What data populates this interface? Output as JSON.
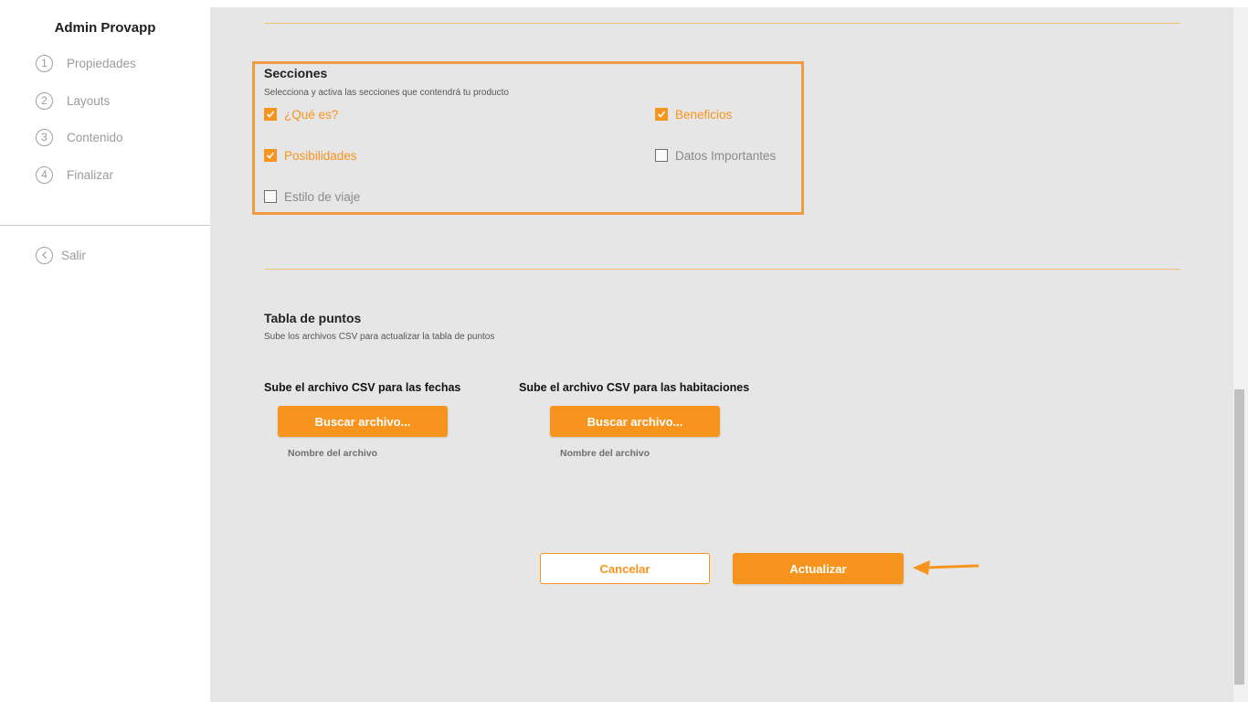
{
  "sidebar": {
    "brand": "Admin Provapp",
    "steps": [
      {
        "num": "1",
        "label": "Propiedades"
      },
      {
        "num": "2",
        "label": "Layouts"
      },
      {
        "num": "3",
        "label": "Contenido"
      },
      {
        "num": "4",
        "label": "Finalizar"
      }
    ],
    "exit_label": "Salir"
  },
  "sections": {
    "title": "Secciones",
    "subtitle": "Selecciona y activa las secciones que contendrá tu producto",
    "items": [
      {
        "label": "¿Qué es?",
        "checked": true
      },
      {
        "label": "Beneficios",
        "checked": true
      },
      {
        "label": "Posibilidades",
        "checked": true
      },
      {
        "label": "Datos Importantes",
        "checked": false
      },
      {
        "label": "Estilo de viaje",
        "checked": false
      }
    ]
  },
  "points_table": {
    "title": "Tabla de puntos",
    "subtitle": "Sube los archivos CSV para actualizar la tabla de puntos",
    "uploads": [
      {
        "label": "Sube el archivo CSV para las fechas",
        "button": "Buscar archivo...",
        "file_name": "Nombre del archivo"
      },
      {
        "label": "Sube el archivo CSV para las habitaciones",
        "button": "Buscar archivo...",
        "file_name": "Nombre del archivo"
      }
    ]
  },
  "actions": {
    "cancel": "Cancelar",
    "update": "Actualizar"
  },
  "colors": {
    "accent": "#f7941d",
    "highlight_border": "#ef9a45",
    "background": "#e6e6e6"
  },
  "icons": {
    "checkbox_checked": "check-icon",
    "exit": "chevron-left-circle-icon",
    "pointer": "arrow-left-icon"
  }
}
